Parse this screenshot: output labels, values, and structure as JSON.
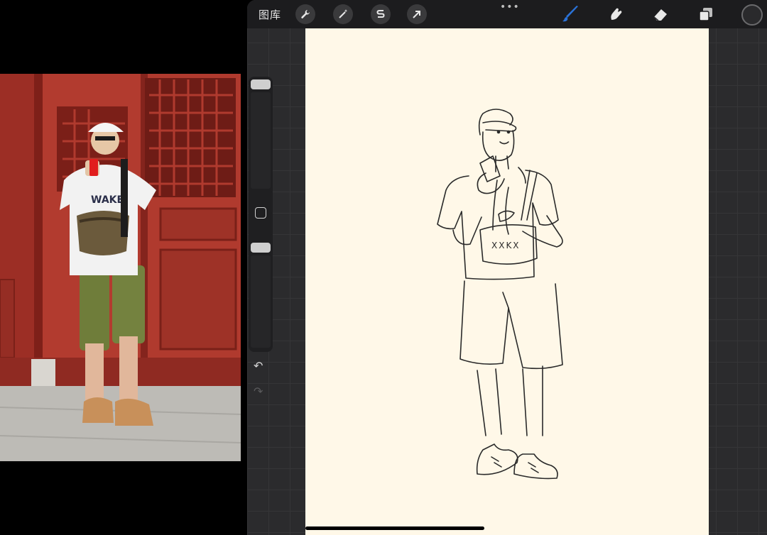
{
  "toolbar": {
    "gallery_label": "图库",
    "more_dots": "•••",
    "icons": [
      "wrench-icon",
      "magic-wand-icon",
      "selection-s-icon",
      "transform-arrow-icon",
      "brush-icon",
      "smudge-icon",
      "eraser-icon",
      "layers-icon"
    ],
    "active_tool": "brush",
    "active_color": "#2a72d8",
    "current_color": "#2a2a2c"
  },
  "sidebar": {
    "undo_icon": "↶",
    "redo_icon": "↷"
  },
  "canvas": {
    "background": "#fff8e8",
    "bag_text": "XXKX"
  },
  "reference": {
    "shirt_text": "WAKE"
  }
}
